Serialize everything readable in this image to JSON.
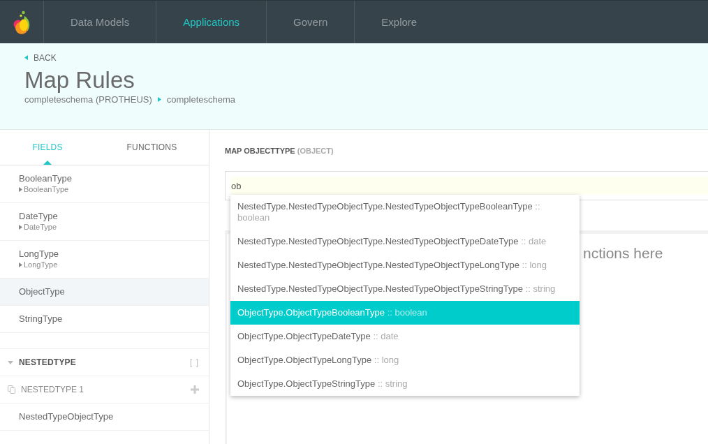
{
  "nav": {
    "tabs": [
      {
        "label": "Data Models",
        "selected": false
      },
      {
        "label": "Applications",
        "selected": true
      },
      {
        "label": "Govern",
        "selected": false
      },
      {
        "label": "Explore",
        "selected": false
      }
    ]
  },
  "header": {
    "back": "BACK",
    "title": "Map Rules",
    "breadcrumb": [
      "completeschema (PROTHEUS)",
      "completeschema"
    ]
  },
  "sidebar": {
    "tabs": [
      {
        "label": "FIELDS",
        "selected": true
      },
      {
        "label": "FUNCTIONS",
        "selected": false
      }
    ],
    "fields": [
      {
        "name": "BooleanType",
        "type": "BooleanType",
        "selected": false
      },
      {
        "name": "DateType",
        "type": "DateType",
        "selected": false
      },
      {
        "name": "LongType",
        "type": "LongType",
        "selected": false
      },
      {
        "name": "ObjectType",
        "selected": true
      },
      {
        "name": "StringType",
        "selected": false
      }
    ],
    "groups": [
      {
        "title": "NESTEDTYPE",
        "expanded": true,
        "array_mark": "[ ]",
        "instances": [
          {
            "label": "NESTEDTYPE 1",
            "fields": [
              {
                "name": "NestedTypeObjectType",
                "selected": false
              }
            ]
          }
        ]
      }
    ]
  },
  "mapping": {
    "label": "MAP OBJECTTYPE",
    "label_type": "(OBJECT)",
    "input": {
      "value": "ob"
    },
    "suggestions": [
      {
        "path": "NestedType.NestedTypeObjectType.NestedTypeObjectTypeBooleanType",
        "type": ":: boolean",
        "selected": false
      },
      {
        "path": "NestedType.NestedTypeObjectType.NestedTypeObjectTypeDateType",
        "type": ":: date",
        "selected": false
      },
      {
        "path": "NestedType.NestedTypeObjectType.NestedTypeObjectTypeLongType",
        "type": ":: long",
        "selected": false
      },
      {
        "path": "NestedType.NestedTypeObjectType.NestedTypeObjectTypeStringType",
        "type": ":: string",
        "selected": false
      },
      {
        "path": "ObjectType.ObjectTypeBooleanType",
        "type": ":: boolean",
        "selected": true
      },
      {
        "path": "ObjectType.ObjectTypeDateType",
        "type": ":: date",
        "selected": false
      },
      {
        "path": "ObjectType.ObjectTypeLongType",
        "type": ":: long",
        "selected": false
      },
      {
        "path": "ObjectType.ObjectTypeStringType",
        "type": ":: string",
        "selected": false
      }
    ],
    "drop_hint": "nctions here"
  }
}
